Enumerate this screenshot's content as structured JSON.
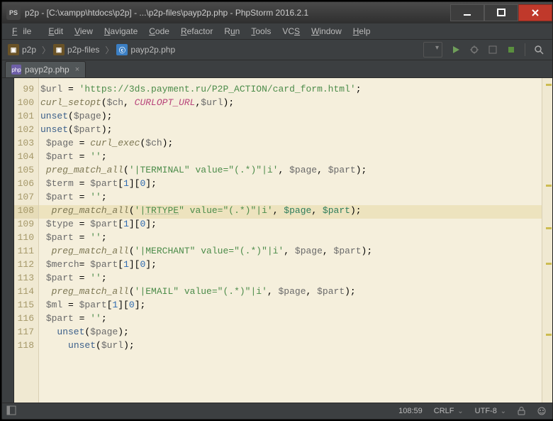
{
  "window_title": "p2p - [C:\\xampp\\htdocs\\p2p] - ...\\p2p-files\\payp2p.php - PhpStorm 2016.2.1",
  "menu": {
    "file": "File",
    "edit": "Edit",
    "view": "View",
    "navigate": "Navigate",
    "code": "Code",
    "refactor": "Refactor",
    "run": "Run",
    "tools": "Tools",
    "vcs": "VCS",
    "window": "Window",
    "help": "Help"
  },
  "breadcrumbs": {
    "p1": "p2p",
    "p2": "p2p-files",
    "p3": "payp2p.php"
  },
  "tab": {
    "label": "payp2p.php"
  },
  "status": {
    "caret": "108:59",
    "eol": "CRLF",
    "enc": "UTF-8"
  },
  "gutter": [
    "99",
    "100",
    "101",
    "102",
    "103",
    "104",
    "105",
    "106",
    "107",
    "108",
    "109",
    "110",
    "111",
    "112",
    "113",
    "114",
    "115",
    "116",
    "117",
    "118"
  ],
  "highlight_index": 9,
  "code": {
    "l99": {
      "var": "$url",
      "eq": " = ",
      "str": "'https://3ds.payment.ru/P2P_ACTION/card_form.html'",
      "sc": ";"
    },
    "l100": {
      "fn": "curl_setopt",
      "op": "(",
      "v1": "$ch",
      "cm": ", ",
      "c": "CURLOPT_URL",
      "cm2": ",",
      "v2": "$url",
      "cp": ");"
    },
    "l101": {
      "kw": "unset",
      "op": "(",
      "v": "$page",
      "cp": ");"
    },
    "l102": {
      "kw": "unset",
      "op": "(",
      "v": "$part",
      "cp": ");"
    },
    "l103": {
      "v": "$page",
      "rest": " = ",
      "fn": "curl_exec",
      "op": "(",
      "v2": "$ch",
      "cp": ");"
    },
    "l104": {
      "v": "$part",
      "rest": " = ",
      "s": "''",
      "sc": ";"
    },
    "l105": {
      "fn": "preg_match_all",
      "op": "(",
      "s": "'|TERMINAL\" value=\"(.*)\"|i'",
      "cm": ", ",
      "v1": "$page",
      "cm2": ", ",
      "v2": "$part",
      "cp": ");"
    },
    "l106": {
      "v": "$term",
      "rest": " = ",
      "v2": "$part",
      "idx": "[",
      "n1": "1",
      "mid": "][",
      "n2": "0",
      "end": "];"
    },
    "l107": {
      "v": "$part",
      "rest": " = ",
      "s": "''",
      "sc": ";"
    },
    "l108": {
      "fn": "preg_match_all",
      "op": "(",
      "s1": "'|",
      "us": "TRTYPE",
      "s2": "\" value=\"(.*)\"|i'",
      "cm": ", ",
      "v1": "$page",
      "cm2": ", ",
      "v2": "$part",
      "cp": ");"
    },
    "l109": {
      "v": "$type",
      "rest": " = ",
      "v2": "$part",
      "idx": "[",
      "n1": "1",
      "mid": "][",
      "n2": "0",
      "end": "];"
    },
    "l110": {
      "v": "$part",
      "rest": " = ",
      "s": "''",
      "sc": ";"
    },
    "l111": {
      "fn": "preg_match_all",
      "op": "(",
      "s": "'|MERCHANT\" value=\"(.*)\"|i'",
      "cm": ", ",
      "v1": "$page",
      "cm2": ", ",
      "v2": "$part",
      "cp": ");"
    },
    "l112": {
      "v": "$merch",
      "rest": "= ",
      "v2": "$part",
      "idx": "[",
      "n1": "1",
      "mid": "][",
      "n2": "0",
      "end": "];"
    },
    "l113": {
      "v": "$part",
      "rest": " = ",
      "s": "''",
      "sc": ";"
    },
    "l114": {
      "fn": "preg_match_all",
      "op": "(",
      "s": "'|EMAIL\" value=\"(.*)\"|i'",
      "cm": ", ",
      "v1": "$page",
      "cm2": ", ",
      "v2": "$part",
      "cp": ");"
    },
    "l115": {
      "v": "$ml",
      "rest": " = ",
      "v2": "$part",
      "idx": "[",
      "n1": "1",
      "mid": "][",
      "n2": "0",
      "end": "];"
    },
    "l116": {
      "v": "$part",
      "rest": " = ",
      "s": "''",
      "sc": ";"
    },
    "l117": {
      "kw": "unset",
      "op": "(",
      "v": "$page",
      "cp": ");"
    },
    "l118": {
      "kw": "unset",
      "op": "(",
      "v": "$url",
      "cp": ");"
    }
  }
}
